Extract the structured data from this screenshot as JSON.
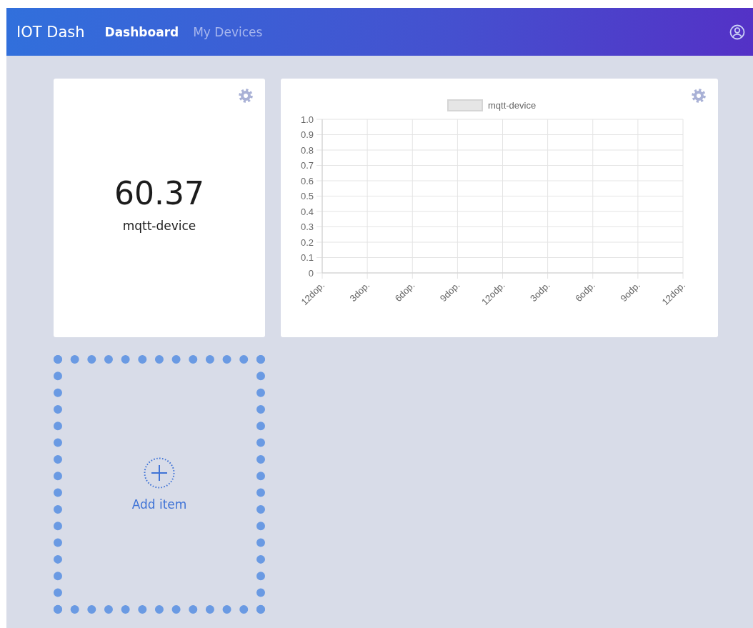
{
  "navbar": {
    "brand": "IOT Dash",
    "links": [
      {
        "label": "Dashboard",
        "selected": true
      },
      {
        "label": "My Devices",
        "selected": false
      }
    ]
  },
  "widgets": [
    {
      "kind": "value",
      "value": "60.37",
      "label": "mqtt-device"
    },
    {
      "kind": "chart",
      "chart_data": {
        "type": "line",
        "categories": [
          "12dop.",
          "3dop.",
          "6dop.",
          "9dop.",
          "12odp.",
          "3odp.",
          "6odp.",
          "9odp.",
          "12dop."
        ],
        "series": [
          {
            "name": "mqtt-device",
            "color": "#e6e6e6",
            "values": [
              null,
              null,
              null,
              null,
              null,
              null,
              null,
              null,
              null
            ]
          }
        ],
        "grid": true,
        "ylim": [
          0,
          1
        ],
        "yticks": [
          {
            "value": 0,
            "label": "0"
          },
          0.1,
          0.2,
          0.3,
          0.4,
          0.5,
          0.6,
          0.7,
          0.8,
          0.9,
          {
            "value": 1,
            "label": "1.0"
          }
        ]
      }
    }
  ],
  "add_item": {
    "label": "Add item"
  }
}
